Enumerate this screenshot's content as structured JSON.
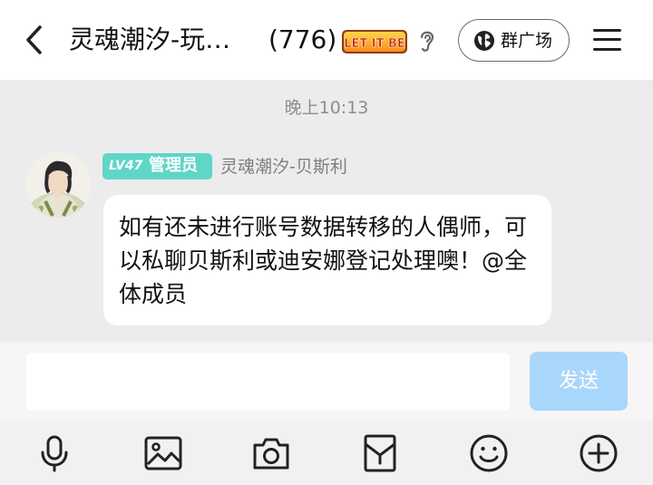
{
  "header": {
    "back_icon": "chevron-left-icon",
    "title": "灵魂潮汐-玩…",
    "member_count": "(776)",
    "title_badge_text": "LET IT BE",
    "ear_icon": "ear-icon",
    "group_square_label": "群广场",
    "group_square_icon": "globe-icon",
    "menu_icon": "hamburger-menu-icon"
  },
  "chat": {
    "timestamp": "晚上10:13",
    "messages": [
      {
        "level": "LV47",
        "role": "管理员",
        "sender": "灵魂潮汐-贝斯利",
        "text": "如有还未进行账号数据转移的人偶师，可以私聊贝斯利或迪安娜登记处理噢！@全体成员"
      }
    ]
  },
  "input": {
    "placeholder": "",
    "send_label": "发送"
  },
  "toolbar": {
    "items": [
      "microphone-icon",
      "image-icon",
      "camera-icon",
      "red-packet-icon",
      "emoji-icon",
      "plus-icon"
    ]
  },
  "colors": {
    "level_badge": "#5fd6c7",
    "send_disabled": "#a9d6fb",
    "chat_background": "#ececec"
  }
}
